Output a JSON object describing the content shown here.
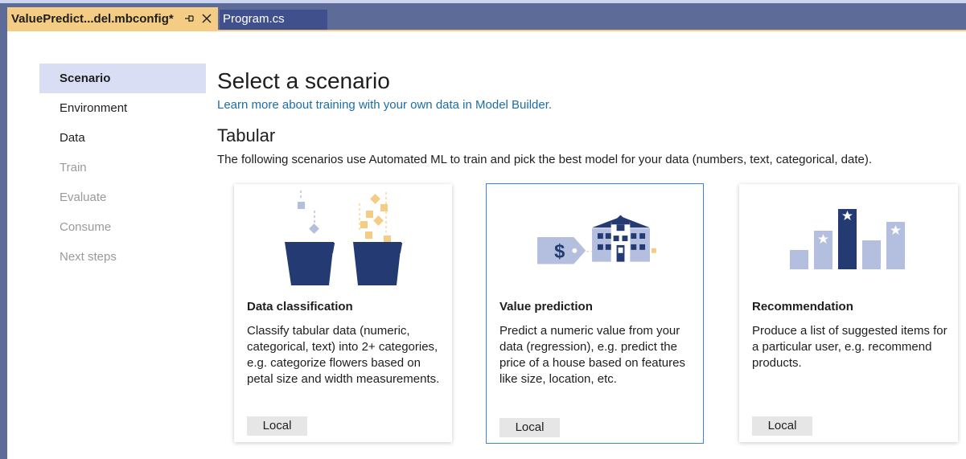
{
  "tabs": {
    "active": {
      "title": "ValuePredict...del.mbconfig*"
    },
    "inactive": {
      "title": "Program.cs"
    }
  },
  "nav": {
    "items": [
      {
        "label": "Scenario",
        "state": "selected"
      },
      {
        "label": "Environment",
        "state": "enabled"
      },
      {
        "label": "Data",
        "state": "enabled"
      },
      {
        "label": "Train",
        "state": "disabled"
      },
      {
        "label": "Evaluate",
        "state": "disabled"
      },
      {
        "label": "Consume",
        "state": "disabled"
      },
      {
        "label": "Next steps",
        "state": "disabled"
      }
    ]
  },
  "main": {
    "heading": "Select a scenario",
    "learn_link": "Learn more about training with your own data in Model Builder.",
    "section_title": "Tabular",
    "section_desc": "The following scenarios use Automated ML to train and pick the best model for your data (numbers, text, categorical, date)."
  },
  "cards": [
    {
      "title": "Data classification",
      "desc": "Classify tabular data (numeric, categorical, text) into 2+ categories, e.g. categorize flowers based on petal size and width measurements.",
      "button": "Local",
      "illustration": "buckets-icon",
      "selected": false
    },
    {
      "title": "Value prediction",
      "desc": "Predict a numeric value from your data (regression), e.g. predict the price of a house based on features like size, location, etc.",
      "button": "Local",
      "illustration": "house-price-tag-icon",
      "selected": true
    },
    {
      "title": "Recommendation",
      "desc": "Produce a list of suggested items for a particular user, e.g. recommend products.",
      "button": "Local",
      "illustration": "star-bar-chart-icon",
      "selected": false
    }
  ],
  "colors": {
    "window_frame": "#5d6b99",
    "active_tab": "#f5cc84",
    "selected_nav": "#dadef5",
    "link": "#1b6ea8",
    "illustration_dark": "#243a73",
    "illustration_light": "#b4bfdf",
    "illustration_accent": "#f5cc84",
    "card_selected_border": "#3b87d6"
  }
}
